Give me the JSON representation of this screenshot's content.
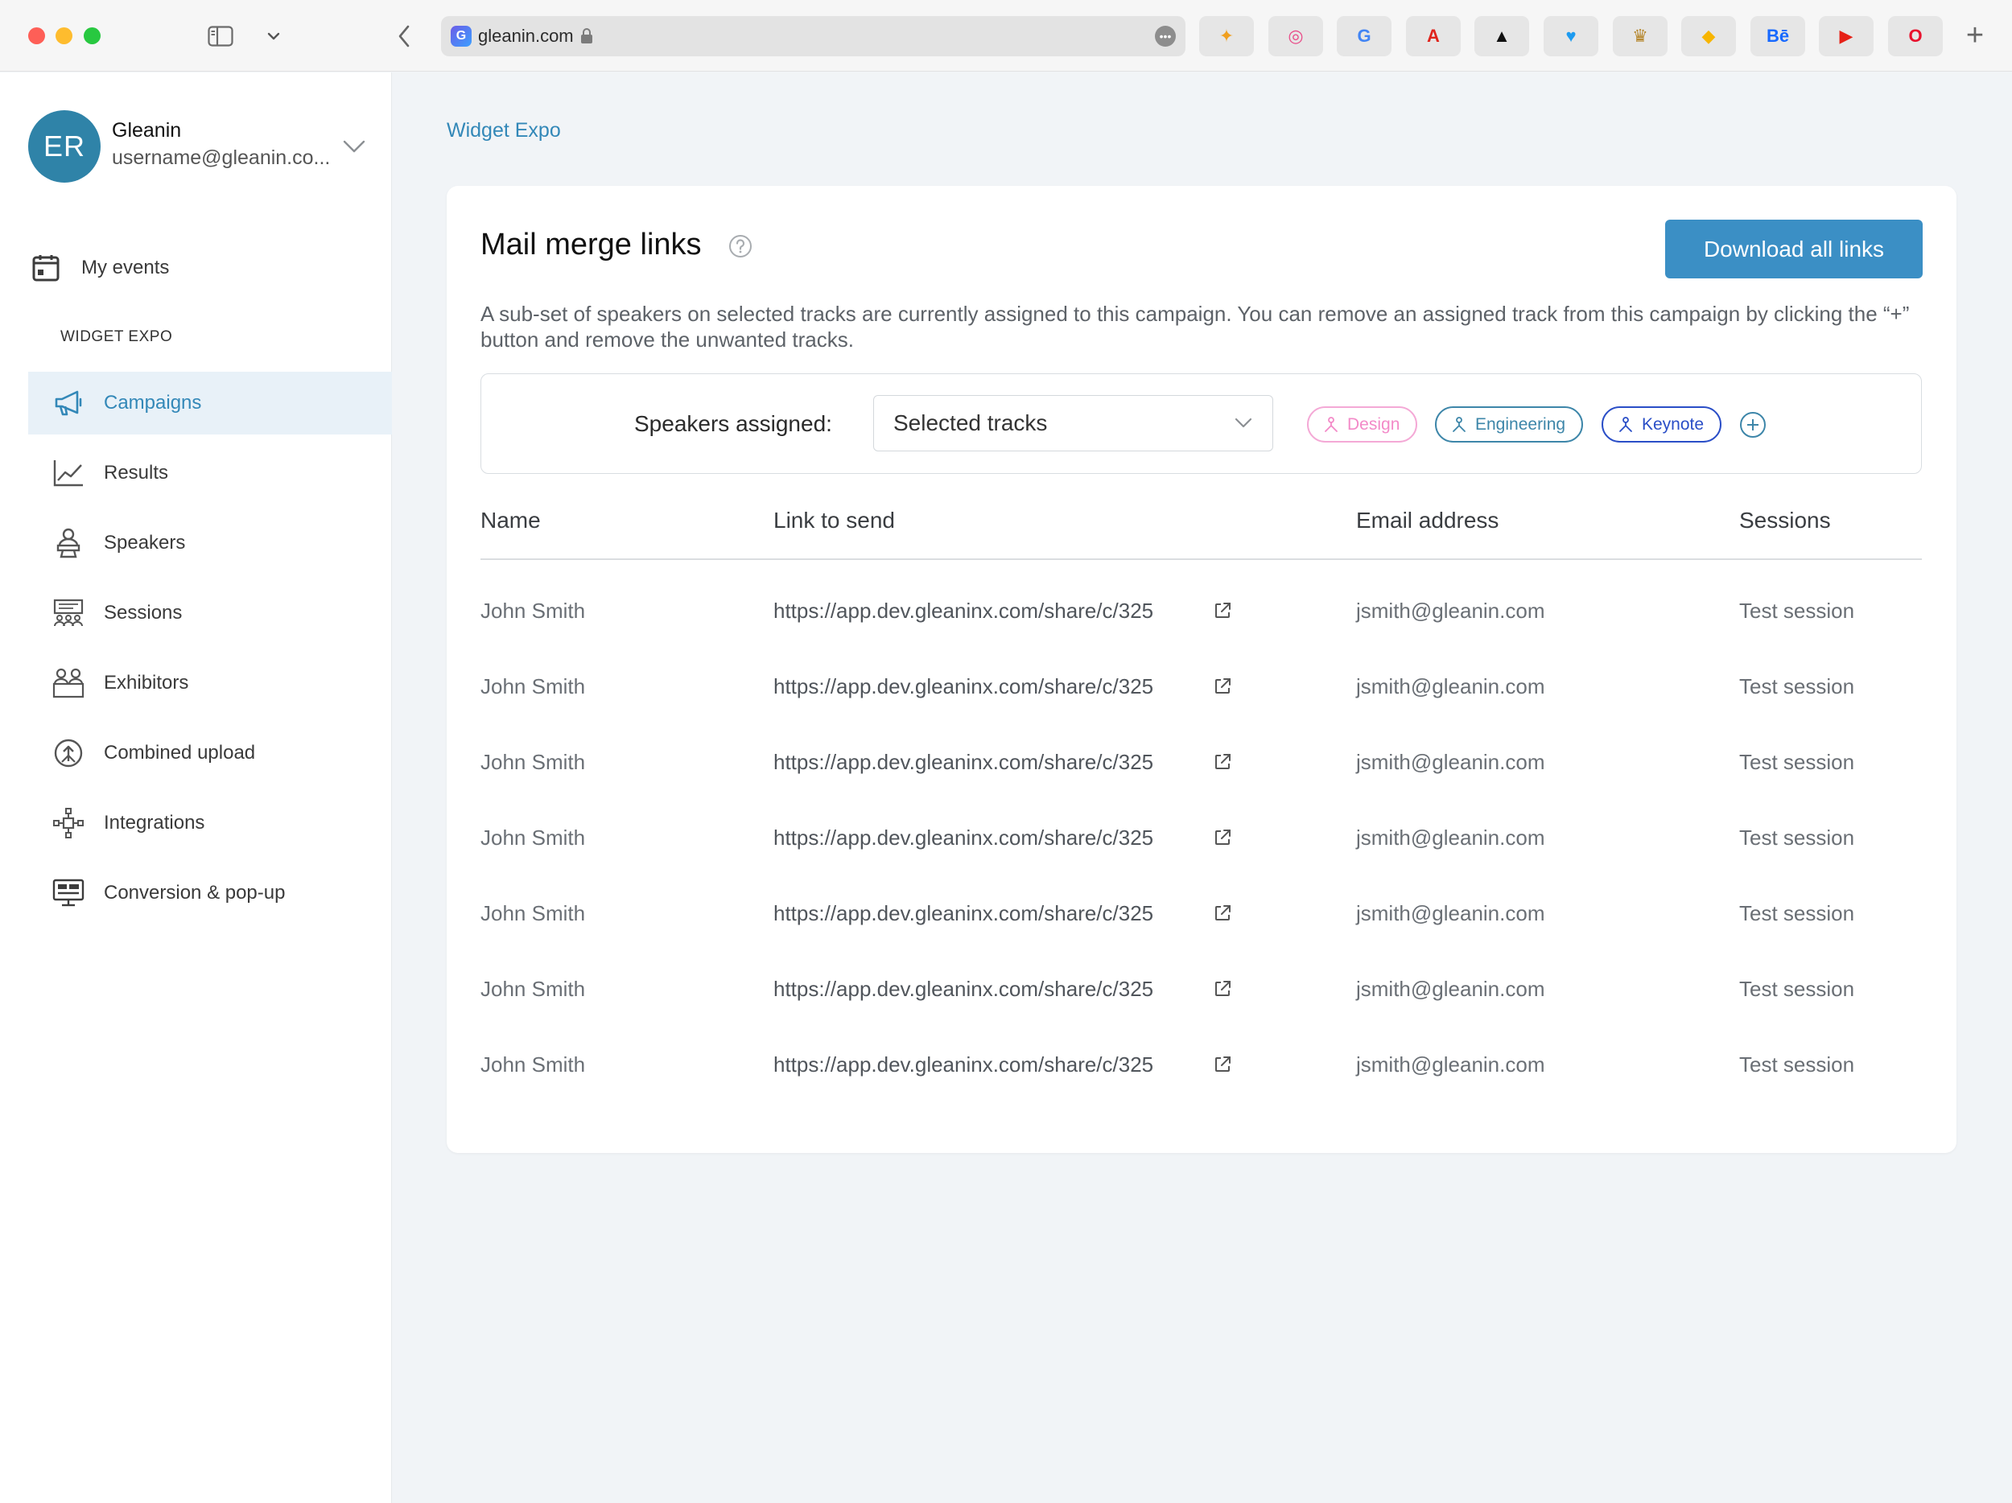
{
  "browser": {
    "url": "gleanin.com",
    "site_logo": "G",
    "more_label": "•••",
    "favorites": [
      {
        "name": "fav-fireworks",
        "glyph": "✦",
        "color": "#f0a020"
      },
      {
        "name": "fav-dribbble",
        "glyph": "◎",
        "color": "#e94b88"
      },
      {
        "name": "fav-google",
        "glyph": "G",
        "color": "#4285f4"
      },
      {
        "name": "fav-adobe",
        "glyph": "A",
        "color": "#e0241c"
      },
      {
        "name": "fav-adidas",
        "glyph": "▲",
        "color": "#111111"
      },
      {
        "name": "fav-twitter",
        "glyph": "♥",
        "color": "#1d9bf0"
      },
      {
        "name": "fav-crown",
        "glyph": "♛",
        "color": "#b5862b"
      },
      {
        "name": "fav-sketch",
        "glyph": "◆",
        "color": "#f7b500"
      },
      {
        "name": "fav-behance",
        "glyph": "Bē",
        "color": "#1769ff"
      },
      {
        "name": "fav-youtube",
        "glyph": "▶",
        "color": "#e62117"
      },
      {
        "name": "fav-opera",
        "glyph": "O",
        "color": "#e8112d"
      }
    ],
    "new_tab": "+"
  },
  "account": {
    "initials": "ER",
    "name": "Gleanin",
    "email": "username@gleanin.co..."
  },
  "sidebar": {
    "my_events": "My events",
    "section_title": "WIDGET EXPO",
    "items": [
      {
        "label": "Campaigns",
        "icon": "megaphone-icon"
      },
      {
        "label": "Results",
        "icon": "line-chart-icon"
      },
      {
        "label": "Speakers",
        "icon": "speaker-icon"
      },
      {
        "label": "Sessions",
        "icon": "sessions-icon"
      },
      {
        "label": "Exhibitors",
        "icon": "exhibitors-icon"
      },
      {
        "label": "Combined upload",
        "icon": "upload-icon"
      },
      {
        "label": "Integrations",
        "icon": "integrations-icon"
      },
      {
        "label": "Conversion & pop-up",
        "icon": "monitor-icon"
      }
    ]
  },
  "main": {
    "breadcrumb": "Widget Expo",
    "title": "Mail merge links",
    "download_label": "Download all links",
    "description": "A sub-set of speakers on selected tracks are currently assigned to this campaign. You can remove an assigned track from this campaign by clicking the “+” button and remove the unwanted tracks.",
    "speakers_assigned_label": "Speakers assigned:",
    "select_value": "Selected tracks",
    "tracks": [
      "Design",
      "Engineering",
      "Keynote"
    ],
    "columns": [
      "Name",
      "Link to send",
      "Email address",
      "Sessions"
    ],
    "rows": [
      {
        "name": "John Smith",
        "link": "https://app.dev.gleaninx.com/share/c/325",
        "email": "jsmith@gleanin.com",
        "session": "Test session"
      },
      {
        "name": "John Smith",
        "link": "https://app.dev.gleaninx.com/share/c/325",
        "email": "jsmith@gleanin.com",
        "session": "Test session"
      },
      {
        "name": "John Smith",
        "link": "https://app.dev.gleaninx.com/share/c/325",
        "email": "jsmith@gleanin.com",
        "session": "Test session"
      },
      {
        "name": "John Smith",
        "link": "https://app.dev.gleaninx.com/share/c/325",
        "email": "jsmith@gleanin.com",
        "session": "Test session"
      },
      {
        "name": "John Smith",
        "link": "https://app.dev.gleaninx.com/share/c/325",
        "email": "jsmith@gleanin.com",
        "session": "Test session"
      },
      {
        "name": "John Smith",
        "link": "https://app.dev.gleaninx.com/share/c/325",
        "email": "jsmith@gleanin.com",
        "session": "Test session"
      },
      {
        "name": "John Smith",
        "link": "https://app.dev.gleaninx.com/share/c/325",
        "email": "jsmith@gleanin.com",
        "session": "Test session"
      }
    ]
  },
  "colors": {
    "accent": "#3b8fc5",
    "active_bg": "#e8f1f8",
    "avatar": "#2f83a8",
    "tag_design": "#f38ac8",
    "tag_engineering": "#3d86a9",
    "tag_keynote": "#2a4ec7"
  }
}
